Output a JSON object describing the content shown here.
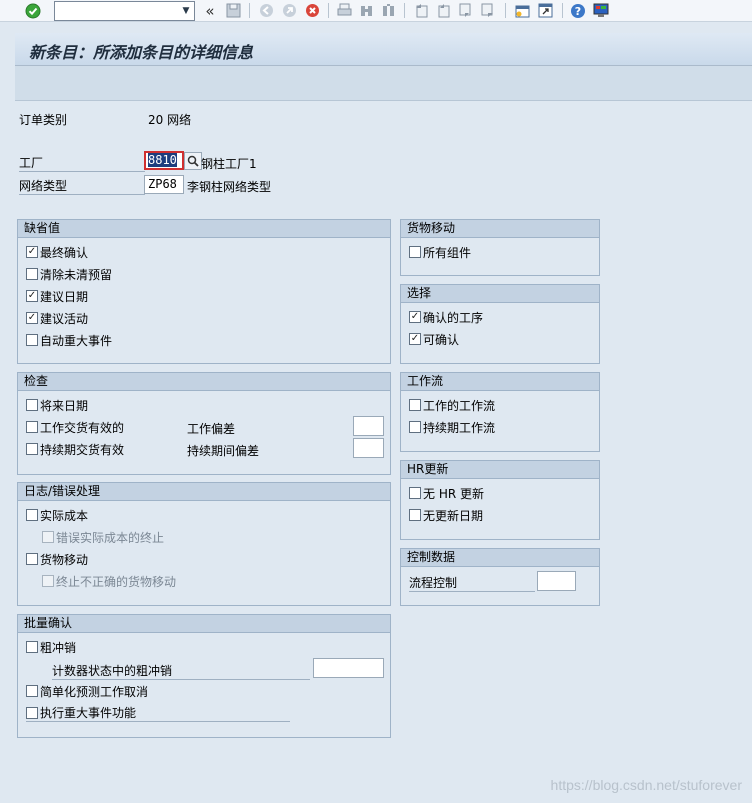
{
  "toolbar": {
    "command_field_value": "",
    "icons": [
      "ok-icon",
      "dropdown-arrow-icon",
      "back-double-icon",
      "save-icon",
      "back-icon",
      "exit-icon",
      "cancel-icon",
      "print-icon",
      "find-icon",
      "find-next-icon",
      "first-page-icon",
      "prev-page-icon",
      "next-page-icon",
      "last-page-icon",
      "new-session-icon",
      "shortcut-icon",
      "help-icon",
      "customize-layout-icon"
    ],
    "back_glyph": "«"
  },
  "title": "新条目：所添加条目的详细信息",
  "header": {
    "order_type_label": "订单类别",
    "order_type_value": "20 网络",
    "plant_label": "工厂",
    "plant_value": "8810",
    "plant_desc": "钢柱工厂1",
    "network_type_label": "网络类型",
    "network_type_value": "ZP68",
    "network_type_desc": "李钢柱网络类型"
  },
  "defaults": {
    "title": "缺省值",
    "items": [
      {
        "label": "最终确认",
        "checked": true
      },
      {
        "label": "清除未清预留",
        "checked": false
      },
      {
        "label": "建议日期",
        "checked": true
      },
      {
        "label": "建议活动",
        "checked": true
      },
      {
        "label": "自动重大事件",
        "checked": false
      }
    ]
  },
  "checks": {
    "title": "检查",
    "future_date": "将来日期",
    "work_delivery": "工作交货有效的",
    "work_deviation": "工作偏差",
    "duration_delivery": "持续期交货有效",
    "duration_deviation": "持续期间偏差"
  },
  "log": {
    "title": "日志/错误处理",
    "actual_cost": "实际成本",
    "error_actual_cost": "错误实际成本的终止",
    "goods_movement": "货物移动",
    "stop_goods_movement": "终止不正确的货物移动"
  },
  "batch": {
    "title": "批量确认",
    "rough_reversal": "粗冲销",
    "counter_rough_reversal": "计数器状态中的粗冲销",
    "simplified_cancel": "简单化预测工作取消",
    "milestone_function": "执行重大事件功能"
  },
  "goods": {
    "title": "货物移动",
    "all_components": "所有组件"
  },
  "selection": {
    "title": "选择",
    "items": [
      {
        "label": "确认的工序",
        "checked": true
      },
      {
        "label": "可确认",
        "checked": true
      }
    ]
  },
  "workflow": {
    "title": "工作流",
    "work_flow": "工作的工作流",
    "duration_flow": "持续期工作流"
  },
  "hr": {
    "title": "HR更新",
    "no_hr_update": "无 HR 更新",
    "no_update_date": "无更新日期"
  },
  "control": {
    "title": "控制数据",
    "process_control": "流程控制"
  },
  "check_glyph": "✓",
  "watermark": "https://blog.csdn.net/stuforever"
}
